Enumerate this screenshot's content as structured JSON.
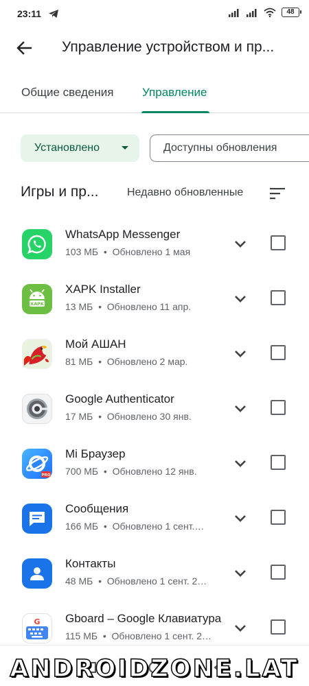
{
  "status_bar": {
    "time": "23:11",
    "battery": "48",
    "icons": [
      "telegram-icon",
      "signal-icon",
      "signal-icon",
      "wifi-icon",
      "battery-icon"
    ]
  },
  "app_bar": {
    "title": "Управление устройством и пр...",
    "back_icon": "arrow-back-icon"
  },
  "tabs": [
    {
      "label": "Общие сведения",
      "active": false
    },
    {
      "label": "Управление",
      "active": true
    }
  ],
  "filters": {
    "installed_label": "Установлено",
    "updates_label": "Доступны обновления"
  },
  "section": {
    "title": "Игры и пр...",
    "sort_label": "Недавно обновленные",
    "sort_icon": "sort-icon"
  },
  "apps": [
    {
      "name": "WhatsApp Messenger",
      "size": "103 МБ",
      "updated": "Обновлено 1 мая",
      "icon": "whatsapp-icon"
    },
    {
      "name": "XAPK Installer",
      "size": "13 МБ",
      "updated": "Обновлено 11 апр.",
      "icon": "xapk-installer-icon"
    },
    {
      "name": "Мой АШАН",
      "size": "81 МБ",
      "updated": "Обновлено 2 мар.",
      "icon": "auchan-icon"
    },
    {
      "name": "Google Authenticator",
      "size": "17 МБ",
      "updated": "Обновлено 30 янв.",
      "icon": "authenticator-icon"
    },
    {
      "name": "Mi Браузер",
      "size": "700 МБ",
      "updated": "Обновлено 12 янв.",
      "icon": "mi-browser-icon"
    },
    {
      "name": "Сообщения",
      "size": "166 МБ",
      "updated": "Обновлено 1 сент.…",
      "icon": "messages-icon"
    },
    {
      "name": "Контакты",
      "size": "48 МБ",
      "updated": "Обновлено 1 сент. 2…",
      "icon": "contacts-icon"
    },
    {
      "name": "Gboard – Google Клавиатура",
      "size": "115 МБ",
      "updated": "Обновлено 1 сент. 2…",
      "icon": "gboard-icon"
    }
  ],
  "separator": "•",
  "watermark": "ANDROIDZONE.LAT",
  "colors": {
    "accent": "#01875f",
    "chip_bg": "#e6f4ea",
    "text_primary": "#202124",
    "text_secondary": "#5f6368"
  }
}
